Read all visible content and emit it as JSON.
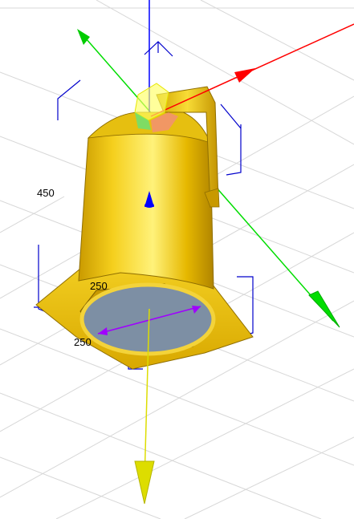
{
  "viewport": {
    "background": "#ffffff",
    "grid_color": "#d7d7d7"
  },
  "object": {
    "name": "spotlight",
    "color": "#f2cc1f",
    "lens_color": "#7d8fa4"
  },
  "dimensions": {
    "height_label": "450",
    "top_width_label": "250",
    "bottom_width_label": "250"
  },
  "axes": {
    "x_color": "#ff0000",
    "y_color": "#00dd00",
    "z_color": "#0000ff",
    "aim_color": "#dddd00",
    "measure_color": "#a000ff"
  },
  "icons": [
    "move-gizmo-icon",
    "axis-arrow-icon",
    "bounding-box-corner-icon"
  ]
}
